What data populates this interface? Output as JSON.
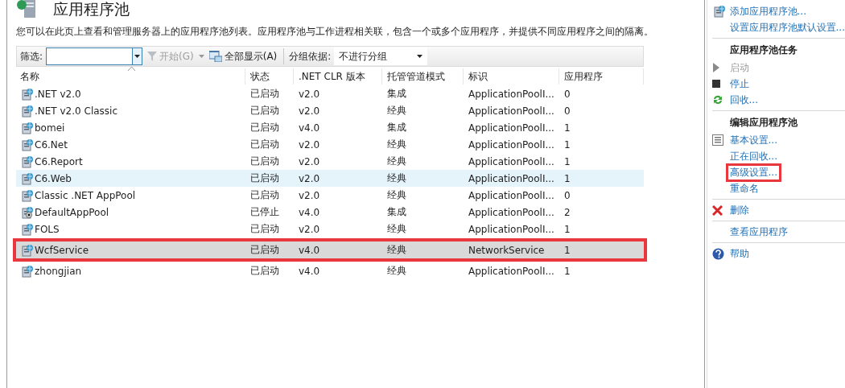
{
  "page": {
    "title": "应用程序池",
    "description": "您可以在此页上查看和管理服务器上的应用程序池列表。应用程序池与工作进程相关联，包含一个或多个应用程序，并提供不同应用程序之间的隔离。"
  },
  "toolbar": {
    "filter_label": "筛选:",
    "start_button": {
      "label": "开始(G)",
      "disabled": true
    },
    "show_all_button": {
      "label": "全部显示(A)"
    },
    "group_label": "分组依据:",
    "group_value": "不进行分组"
  },
  "table": {
    "columns": [
      "名称",
      "状态",
      ".NET CLR 版本",
      "托管管道模式",
      "标识",
      "应用程序"
    ],
    "rows": [
      {
        "cells": [
          ".NET v2.0",
          "已启动",
          "v2.0",
          "集成",
          "ApplicationPoolI...",
          "0"
        ],
        "stopped": false,
        "selected": false,
        "hovered": false
      },
      {
        "cells": [
          ".NET v2.0 Classic",
          "已启动",
          "v2.0",
          "经典",
          "ApplicationPoolI...",
          "0"
        ],
        "stopped": false,
        "selected": false,
        "hovered": false
      },
      {
        "cells": [
          "bomei",
          "已启动",
          "v4.0",
          "集成",
          "ApplicationPoolI...",
          "1"
        ],
        "stopped": false,
        "selected": false,
        "hovered": false
      },
      {
        "cells": [
          "C6.Net",
          "已启动",
          "v2.0",
          "经典",
          "ApplicationPoolI...",
          "1"
        ],
        "stopped": false,
        "selected": false,
        "hovered": false
      },
      {
        "cells": [
          "C6.Report",
          "已启动",
          "v2.0",
          "经典",
          "ApplicationPoolI...",
          "1"
        ],
        "stopped": false,
        "selected": false,
        "hovered": false
      },
      {
        "cells": [
          "C6.Web",
          "已启动",
          "v2.0",
          "经典",
          "ApplicationPoolI...",
          "1"
        ],
        "stopped": false,
        "selected": false,
        "hovered": true
      },
      {
        "cells": [
          "Classic .NET AppPool",
          "已启动",
          "v2.0",
          "经典",
          "ApplicationPoolI...",
          "0"
        ],
        "stopped": false,
        "selected": false,
        "hovered": false
      },
      {
        "cells": [
          "DefaultAppPool",
          "已停止",
          "v4.0",
          "集成",
          "ApplicationPoolI...",
          "2"
        ],
        "stopped": true,
        "selected": false,
        "hovered": false
      },
      {
        "cells": [
          "FOLS",
          "已启动",
          "v2.0",
          "经典",
          "ApplicationPoolI...",
          "1"
        ],
        "stopped": false,
        "selected": false,
        "hovered": false
      },
      {
        "cells": [
          "WcfService",
          "已启动",
          "v4.0",
          "经典",
          "NetworkService",
          "1"
        ],
        "stopped": false,
        "selected": true,
        "hovered": false,
        "highlighted": true
      },
      {
        "cells": [
          "zhongjian",
          "已启动",
          "v4.0",
          "经典",
          "ApplicationPoolI...",
          "1"
        ],
        "stopped": false,
        "selected": false,
        "hovered": false
      }
    ]
  },
  "actions": [
    {
      "kind": "link",
      "label": "添加应用程序池..."
    },
    {
      "kind": "link",
      "label": "设置应用程序池默认设置..."
    },
    {
      "kind": "divider"
    },
    {
      "kind": "heading",
      "label": "应用程序池任务"
    },
    {
      "kind": "link",
      "label": "启动",
      "disabled": true
    },
    {
      "kind": "link",
      "label": "停止"
    },
    {
      "kind": "link",
      "label": "回收..."
    },
    {
      "kind": "divider"
    },
    {
      "kind": "heading",
      "label": "编辑应用程序池"
    },
    {
      "kind": "link",
      "label": "基本设置..."
    },
    {
      "kind": "link",
      "label": "正在回收..."
    },
    {
      "kind": "link",
      "label": "高级设置...",
      "highlighted": true
    },
    {
      "kind": "link",
      "label": "重命名"
    },
    {
      "kind": "divider"
    },
    {
      "kind": "link",
      "label": "删除"
    },
    {
      "kind": "divider"
    },
    {
      "kind": "link",
      "label": "查看应用程序"
    },
    {
      "kind": "divider"
    },
    {
      "kind": "link",
      "label": "帮助"
    }
  ]
}
